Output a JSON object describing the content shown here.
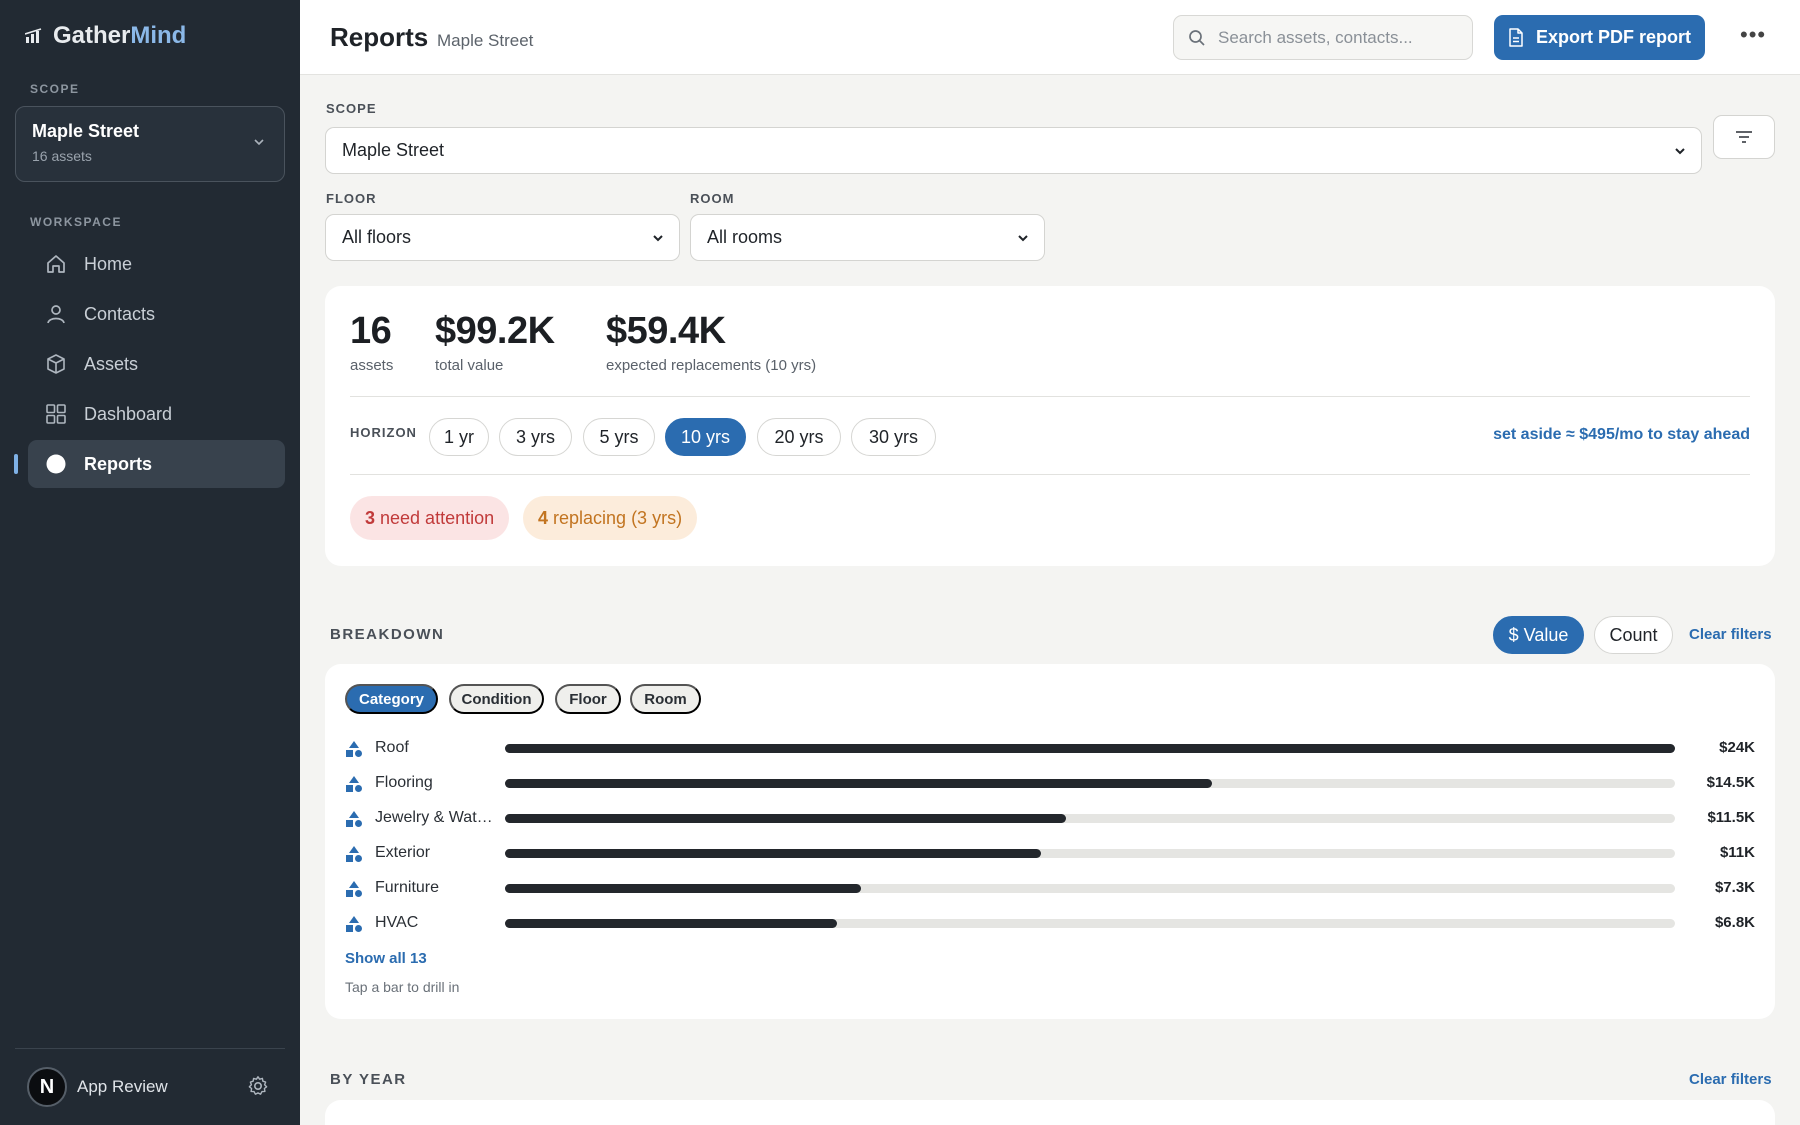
{
  "app": {
    "name_part1": "Gather",
    "name_part2": "Mind"
  },
  "sidebar": {
    "scope_label": "SCOPE",
    "scope_name": "Maple Street",
    "scope_count": "16 assets",
    "workspace_label": "WORKSPACE",
    "items": [
      {
        "label": "Home",
        "icon": "home-icon"
      },
      {
        "label": "Contacts",
        "icon": "person-icon"
      },
      {
        "label": "Assets",
        "icon": "box-icon"
      },
      {
        "label": "Dashboard",
        "icon": "grid-icon"
      },
      {
        "label": "Reports",
        "icon": "circle-icon",
        "active": true
      }
    ],
    "user_initial": "N",
    "user_name": "App Review"
  },
  "header": {
    "title": "Reports",
    "subtitle": "Maple Street",
    "search_placeholder": "Search assets, contacts...",
    "export_label": "Export PDF report",
    "more_label": "•••"
  },
  "filters": {
    "scope_label": "SCOPE",
    "scope_value": "Maple Street",
    "floor_label": "FLOOR",
    "floor_value": "All floors",
    "room_label": "ROOM",
    "room_value": "All rooms"
  },
  "summary": {
    "assets_value": "16",
    "assets_label": "assets",
    "total_value": "$99.2K",
    "total_label": "total value",
    "replacements_value": "$59.4K",
    "replacements_label": "expected replacements (10 yrs)",
    "horizon_label": "HORIZON",
    "horizons": [
      "1 yr",
      "3 yrs",
      "5 yrs",
      "10 yrs",
      "20 yrs",
      "30 yrs"
    ],
    "horizon_selected": "10 yrs",
    "set_aside": "set aside ≈ $495/mo to stay ahead",
    "attention_count": "3",
    "attention_text": "need attention",
    "replacing_count": "4",
    "replacing_text": "replacing (3 yrs)"
  },
  "breakdown": {
    "title": "BREAKDOWN",
    "toggle_value": "$ Value",
    "toggle_count": "Count",
    "clear_filters": "Clear filters",
    "chips": [
      "Category",
      "Condition",
      "Floor",
      "Room"
    ],
    "chip_selected": "Category",
    "rows": [
      {
        "name": "Roof",
        "value": "$24K",
        "amount": 24
      },
      {
        "name": "Flooring",
        "value": "$14.5K",
        "amount": 14.5
      },
      {
        "name": "Jewelry & Watches",
        "value": "$11.5K",
        "amount": 11.5
      },
      {
        "name": "Exterior",
        "value": "$11K",
        "amount": 11
      },
      {
        "name": "Furniture",
        "value": "$7.3K",
        "amount": 7.3
      },
      {
        "name": "HVAC",
        "value": "$6.8K",
        "amount": 6.8
      }
    ],
    "show_all": "Show all 13",
    "hint": "Tap a bar to drill in"
  },
  "by_year": {
    "title": "BY YEAR",
    "clear_filters": "Clear filters"
  },
  "colors": {
    "accent": "#2b6cb0",
    "sidebar_bg": "#222a33",
    "bar_fill": "#23272c",
    "danger": "#c13a3a",
    "warning": "#c27420"
  }
}
